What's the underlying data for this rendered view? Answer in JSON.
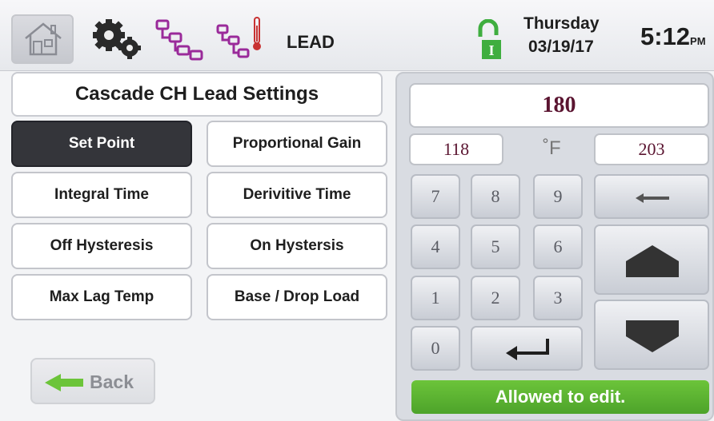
{
  "header": {
    "mode_label": "LEAD",
    "day": "Thursday",
    "date": "03/19/17",
    "time": "5:12",
    "ampm": "PM",
    "icons": [
      "home-icon",
      "gear-icon",
      "boiler-tree-icon",
      "boiler-tree-thermometer-icon",
      "lock-open-icon"
    ]
  },
  "panel": {
    "title": "Cascade CH Lead Settings",
    "settings": [
      {
        "label": "Set Point",
        "active": true
      },
      {
        "label": "Proportional Gain",
        "active": false
      },
      {
        "label": "Integral Time",
        "active": false
      },
      {
        "label": "Derivitive Time",
        "active": false
      },
      {
        "label": "Off Hysteresis",
        "active": false
      },
      {
        "label": "On Hystersis",
        "active": false
      },
      {
        "label": "Max Lag Temp",
        "active": false
      },
      {
        "label": "Base / Drop Load",
        "active": false
      }
    ],
    "back_label": "Back"
  },
  "keypad": {
    "value": "180",
    "min": "118",
    "unit": "˚F",
    "max": "203",
    "keys": [
      "7",
      "8",
      "9",
      "4",
      "5",
      "6",
      "1",
      "2",
      "3",
      "0"
    ],
    "status": "Allowed to edit."
  },
  "colors": {
    "active_button": "#34353a",
    "status_green": "#5cb531",
    "value_text": "#5a1430",
    "lock_green": "#3fae3f",
    "tree_purple": "#9a2a9a"
  }
}
